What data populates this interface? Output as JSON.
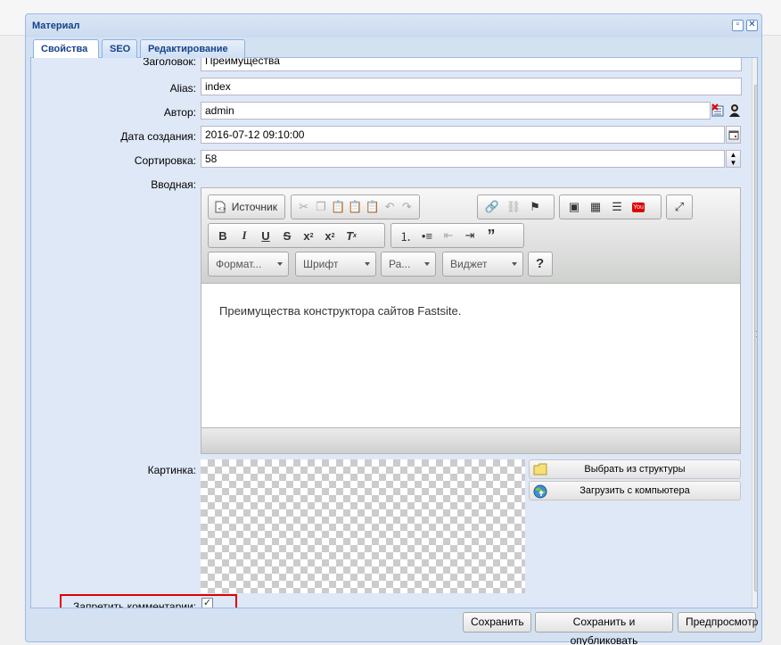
{
  "window": {
    "title": "Материал"
  },
  "tabs": [
    {
      "label": "Свойства",
      "active": true
    },
    {
      "label": "SEO",
      "active": false
    },
    {
      "label": "Редактирование",
      "active": false
    }
  ],
  "fields": {
    "title": {
      "label": "Заголовок:",
      "value": "Преимущества"
    },
    "alias": {
      "label": "Alias:",
      "value": "index"
    },
    "author": {
      "label": "Автор:",
      "value": "admin"
    },
    "created": {
      "label": "Дата создания:",
      "value": "2016-07-12 09:10:00"
    },
    "sort": {
      "label": "Сортировка:",
      "value": "58"
    },
    "intro": {
      "label": "Вводная:"
    },
    "image": {
      "label": "Картинка:"
    },
    "no_comments": {
      "label": "Запретить комментарии:",
      "checked": true
    }
  },
  "editor": {
    "source_label": "Источник",
    "format_label": "Формат...",
    "font_label": "Шрифт",
    "size_label": "Ра...",
    "widget_label": "Виджет",
    "help_label": "?",
    "content": "Преимущества конструктора сайтов Fastsite."
  },
  "image_buttons": {
    "from_structure": "Выбрать из структуры",
    "upload": "Загрузить с компьютера"
  },
  "footer": {
    "save": "Сохранить",
    "save_publish": "Сохранить и опубликовать",
    "preview": "Предпросмотр"
  },
  "colors": {
    "window_border": "#99bbe8",
    "title_text": "#15428b",
    "panel_bg": "#dfe8f6",
    "highlight": "#e00000"
  }
}
